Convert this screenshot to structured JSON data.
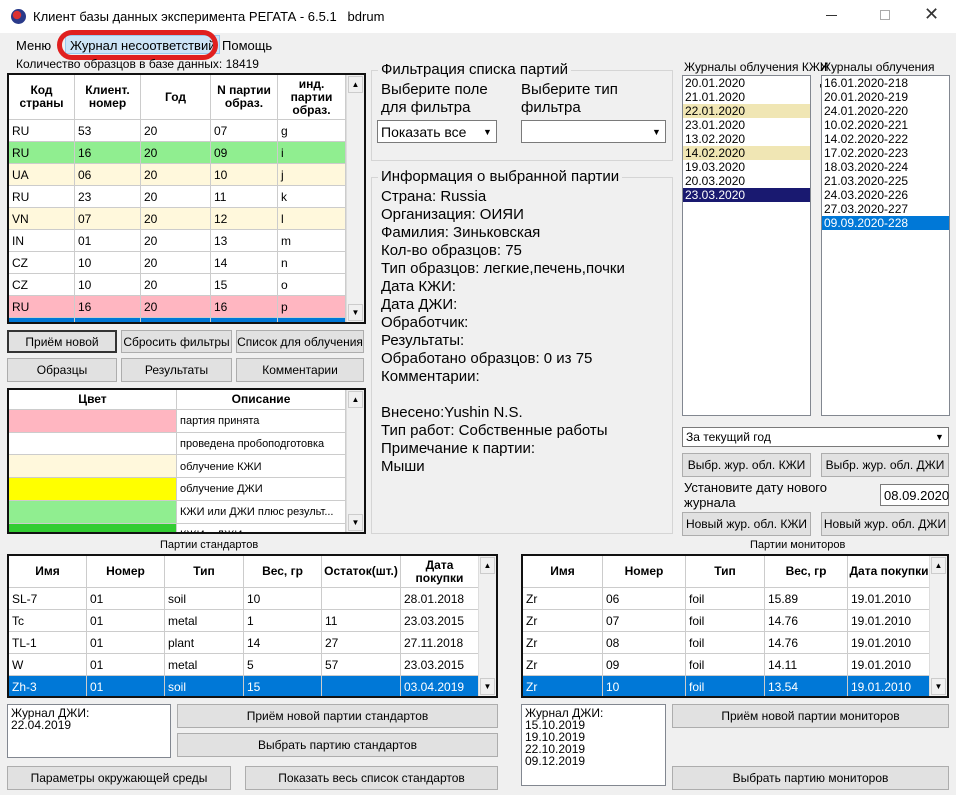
{
  "window": {
    "title": "Клиент базы данных эксперимента РЕГАТА - 6.5.1   bdrum"
  },
  "menu": {
    "items": [
      "Меню",
      "Журнал несоответствий",
      "Помощь"
    ],
    "highlighted": 1
  },
  "sample_count_label": "Количество образцов в базе данных: 18419",
  "samples_table": {
    "columns": [
      "Код страны",
      "Клиент. номер",
      "Год",
      "N партии образ.",
      "инд. партии образ."
    ],
    "rows": [
      {
        "cells": [
          "RU",
          "53",
          "20",
          "07",
          "g"
        ],
        "color": "#ffffff"
      },
      {
        "cells": [
          "RU",
          "16",
          "20",
          "09",
          "i"
        ],
        "color": "#90ee90"
      },
      {
        "cells": [
          "UA",
          "06",
          "20",
          "10",
          "j"
        ],
        "color": "#fff8dc"
      },
      {
        "cells": [
          "RU",
          "23",
          "20",
          "11",
          "k"
        ],
        "color": "#ffffff"
      },
      {
        "cells": [
          "VN",
          "07",
          "20",
          "12",
          "l"
        ],
        "color": "#fff8dc"
      },
      {
        "cells": [
          "IN",
          "01",
          "20",
          "13",
          "m"
        ],
        "color": "#ffffff"
      },
      {
        "cells": [
          "CZ",
          "10",
          "20",
          "14",
          "n"
        ],
        "color": "#ffffff"
      },
      {
        "cells": [
          "CZ",
          "10",
          "20",
          "15",
          "o"
        ],
        "color": "#ffffff"
      },
      {
        "cells": [
          "RU",
          "16",
          "20",
          "16",
          "p"
        ],
        "color": "#ffb6c1"
      },
      {
        "cells": [
          "",
          "",
          "",
          "",
          ""
        ],
        "color": "#0078d7",
        "selected": true
      }
    ]
  },
  "buttons": {
    "accept_new": "Приём новой",
    "reset_filters": "Сбросить фильтры",
    "irradiation_list": "Список для облучения",
    "samples": "Образцы",
    "results": "Результаты",
    "comments": "Комментарии"
  },
  "legend_table": {
    "columns": [
      "Цвет",
      "Описание"
    ],
    "rows": [
      {
        "color": "#ffb6c1",
        "desc": "партия принята"
      },
      {
        "color": "#ffffff",
        "desc": "проведена пробоподготовка"
      },
      {
        "color": "#fff8dc",
        "desc": "облучение КЖИ"
      },
      {
        "color": "#ffff00",
        "desc": "облучение ДЖИ"
      },
      {
        "color": "#90ee90",
        "desc": "КЖИ или ДЖИ плюс результ..."
      },
      {
        "color": "#32cd32",
        "desc": "КЖИ и ДЖИ плюс результаты"
      }
    ]
  },
  "filter": {
    "title": "Фильтрация списка партий",
    "field_label": "Выберите поле для фильтра",
    "type_label": "Выберите тип фильтра",
    "field_value": "Показать все",
    "type_value": ""
  },
  "info": {
    "title": "Информация о выбранной партии",
    "lines": [
      "Страна: Russia",
      "Организация: ОИЯИ",
      "Фамилия: Зиньковская",
      "Кол-во образцов: 75",
      "Тип образцов: легкие,печень,почки",
      "Дата КЖИ:",
      "Дата ДЖИ:",
      "Обработчик:",
      "Результаты:",
      "Обработано образцов: 0 из 75",
      "Комментарии:",
      "",
      "Внесено:Yushin N.S.",
      "Тип работ: Собственные работы",
      "Примечание к партии:",
      "Мыши"
    ]
  },
  "journals": {
    "kzhi_label": "Журналы облучения КЖИ",
    "dzhi_label": "Журналы облучения ДЖИ",
    "kzhi": [
      {
        "t": "20.01.2020"
      },
      {
        "t": "21.01.2020"
      },
      {
        "t": "22.01.2020",
        "hl": true
      },
      {
        "t": "23.01.2020"
      },
      {
        "t": "13.02.2020"
      },
      {
        "t": "14.02.2020",
        "hl": true
      },
      {
        "t": "19.03.2020"
      },
      {
        "t": "20.03.2020"
      },
      {
        "t": "23.03.2020",
        "sel": true
      }
    ],
    "dzhi": [
      {
        "t": "16.01.2020-218"
      },
      {
        "t": "20.01.2020-219"
      },
      {
        "t": "24.01.2020-220"
      },
      {
        "t": "10.02.2020-221"
      },
      {
        "t": "14.02.2020-222"
      },
      {
        "t": "17.02.2020-223"
      },
      {
        "t": "18.03.2020-224"
      },
      {
        "t": "21.03.2020-225"
      },
      {
        "t": "24.03.2020-226"
      },
      {
        "t": "27.03.2020-227"
      },
      {
        "t": "09.09.2020-228",
        "sel": true
      }
    ],
    "period": "За текущий год",
    "select_kzhi": "Выбр. жур. обл. КЖИ",
    "select_dzhi": "Выбр. жур. обл. ДЖИ",
    "new_date_label": "Установите дату нового журнала",
    "new_date": "08.09.2020",
    "new_kzhi": "Новый жур. обл. КЖИ",
    "new_dzhi": "Новый жур. обл. ДЖИ"
  },
  "standards": {
    "title": "Партии стандартов",
    "columns": [
      "Имя",
      "Номер",
      "Тип",
      "Вес, гр",
      "Остаток(шт.)",
      "Дата покупки"
    ],
    "rows": [
      [
        "SL-7",
        "01",
        "soil",
        "10",
        "",
        "28.01.2018"
      ],
      [
        "Tc",
        "01",
        "metal",
        "1",
        "11",
        "23.03.2015"
      ],
      [
        "TL-1",
        "01",
        "plant",
        "14",
        "27",
        "27.11.2018"
      ],
      [
        "W",
        "01",
        "metal",
        "5",
        "57",
        "23.03.2015"
      ],
      [
        "Zh-3",
        "01",
        "soil",
        "15",
        "",
        "03.04.2019"
      ]
    ],
    "selected": 4,
    "journal": "Журнал ДЖИ:\n22.04.2019",
    "accept_new": "Приём новой партии стандартов",
    "select": "Выбрать партию стандартов",
    "env_params": "Параметры окружающей среды",
    "show_all": "Показать весь список стандартов"
  },
  "monitors": {
    "title": "Партии мониторов",
    "columns": [
      "Имя",
      "Номер",
      "Тип",
      "Вес, гр",
      "Дата покупки"
    ],
    "rows": [
      [
        "Zr",
        "06",
        "foil",
        "15.89",
        "19.01.2010"
      ],
      [
        "Zr",
        "07",
        "foil",
        "14.76",
        "19.01.2010"
      ],
      [
        "Zr",
        "08",
        "foil",
        "14.76",
        "19.01.2010"
      ],
      [
        "Zr",
        "09",
        "foil",
        "14.11",
        "19.01.2010"
      ],
      [
        "Zr",
        "10",
        "foil",
        "13.54",
        "19.01.2010"
      ]
    ],
    "selected": 4,
    "journal": "Журнал ДЖИ:\n15.10.2019\n19.10.2019\n22.10.2019\n09.12.2019",
    "accept_new": "Приём новой партии мониторов",
    "select": "Выбрать партию мониторов"
  },
  "colors": {
    "selection": "#0078d7",
    "kzhi_selection": "#191970",
    "annotation": "#e02020",
    "menu_highlight": "#cce4f7"
  }
}
